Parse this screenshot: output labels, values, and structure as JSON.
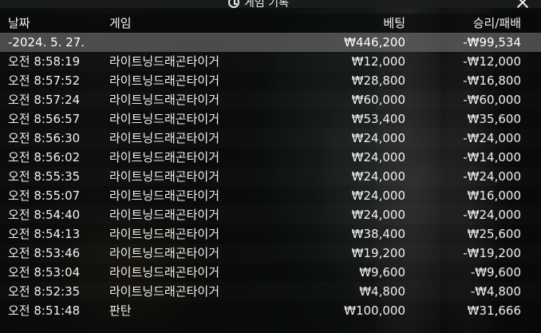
{
  "window": {
    "title": "게임 기록",
    "history_icon": "history-icon",
    "close_icon": "close-icon"
  },
  "table": {
    "headers": {
      "date": "날짜",
      "game": "게임",
      "bet": "베팅",
      "result": "승리/패배"
    },
    "summary": {
      "date": "-2024. 5. 27.",
      "game": "",
      "bet": "₩446,200",
      "result": "-₩99,534"
    },
    "rows": [
      {
        "date": "오전 8:58:19",
        "game": "라이트닝드래곤타이거",
        "bet": "₩12,000",
        "result": "-₩12,000"
      },
      {
        "date": "오전 8:57:52",
        "game": "라이트닝드래곤타이거",
        "bet": "₩28,800",
        "result": "-₩16,800"
      },
      {
        "date": "오전 8:57:24",
        "game": "라이트닝드래곤타이거",
        "bet": "₩60,000",
        "result": "-₩60,000"
      },
      {
        "date": "오전 8:56:57",
        "game": "라이트닝드래곤타이거",
        "bet": "₩53,400",
        "result": "₩35,600"
      },
      {
        "date": "오전 8:56:30",
        "game": "라이트닝드래곤타이거",
        "bet": "₩24,000",
        "result": "-₩24,000"
      },
      {
        "date": "오전 8:56:02",
        "game": "라이트닝드래곤타이거",
        "bet": "₩24,000",
        "result": "-₩14,000"
      },
      {
        "date": "오전 8:55:35",
        "game": "라이트닝드래곤타이거",
        "bet": "₩24,000",
        "result": "-₩24,000"
      },
      {
        "date": "오전 8:55:07",
        "game": "라이트닝드래곤타이거",
        "bet": "₩24,000",
        "result": "₩16,000"
      },
      {
        "date": "오전 8:54:40",
        "game": "라이트닝드래곤타이거",
        "bet": "₩24,000",
        "result": "-₩24,000"
      },
      {
        "date": "오전 8:54:13",
        "game": "라이트닝드래곤타이거",
        "bet": "₩38,400",
        "result": "₩25,600"
      },
      {
        "date": "오전 8:53:46",
        "game": "라이트닝드래곤타이거",
        "bet": "₩19,200",
        "result": "-₩19,200"
      },
      {
        "date": "오전 8:53:04",
        "game": "라이트닝드래곤타이거",
        "bet": "₩9,600",
        "result": "-₩9,600"
      },
      {
        "date": "오전 8:52:35",
        "game": "라이트닝드래곤타이거",
        "bet": "₩4,800",
        "result": "-₩4,800"
      },
      {
        "date": "오전 8:51:48",
        "game": "판탄",
        "bet": "₩100,000",
        "result": "₩31,666"
      }
    ]
  }
}
